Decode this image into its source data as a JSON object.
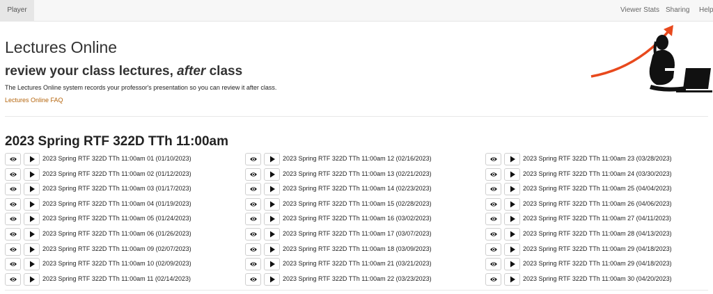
{
  "nav": {
    "player": "Player",
    "viewer_stats": "Viewer Stats",
    "sharing": "Sharing",
    "help": "Help"
  },
  "header": {
    "title": "Lectures Online",
    "subtitle_pre": "review your class lectures, ",
    "subtitle_em": "after",
    "subtitle_post": " class",
    "description": "The Lectures Online system records your professor's presentation so you can review it after class.",
    "faq_link": "Lectures Online FAQ"
  },
  "course": {
    "title": "2023 Spring RTF 322D TTh 11:00am",
    "lectures": [
      "2023 Spring RTF 322D TTh 11:00am 01 (01/10/2023)",
      "2023 Spring RTF 322D TTh 11:00am 02 (01/12/2023)",
      "2023 Spring RTF 322D TTh 11:00am 03 (01/17/2023)",
      "2023 Spring RTF 322D TTh 11:00am 04 (01/19/2023)",
      "2023 Spring RTF 322D TTh 11:00am 05 (01/24/2023)",
      "2023 Spring RTF 322D TTh 11:00am 06 (01/26/2023)",
      "2023 Spring RTF 322D TTh 11:00am 09 (02/07/2023)",
      "2023 Spring RTF 322D TTh 11:00am 10 (02/09/2023)",
      "2023 Spring RTF 322D TTh 11:00am 11 (02/14/2023)",
      "2023 Spring RTF 322D TTh 11:00am 12 (02/16/2023)",
      "2023 Spring RTF 322D TTh 11:00am 13 (02/21/2023)",
      "2023 Spring RTF 322D TTh 11:00am 14 (02/23/2023)",
      "2023 Spring RTF 322D TTh 11:00am 15 (02/28/2023)",
      "2023 Spring RTF 322D TTh 11:00am 16 (03/02/2023)",
      "2023 Spring RTF 322D TTh 11:00am 17 (03/07/2023)",
      "2023 Spring RTF 322D TTh 11:00am 18 (03/09/2023)",
      "2023 Spring RTF 322D TTh 11:00am 21 (03/21/2023)",
      "2023 Spring RTF 322D TTh 11:00am 22 (03/23/2023)",
      "2023 Spring RTF 322D TTh 11:00am 23 (03/28/2023)",
      "2023 Spring RTF 322D TTh 11:00am 24 (03/30/2023)",
      "2023 Spring RTF 322D TTh 11:00am 25 (04/04/2023)",
      "2023 Spring RTF 322D TTh 11:00am 26 (04/06/2023)",
      "2023 Spring RTF 322D TTh 11:00am 27 (04/11/2023)",
      "2023 Spring RTF 322D TTh 11:00am 28 (04/13/2023)",
      "2023 Spring RTF 322D TTh 11:00am 29 (04/18/2023)",
      "2023 Spring RTF 322D TTh 11:00am 29 (04/18/2023)",
      "2023 Spring RTF 322D TTh 11:00am 30 (04/20/2023)"
    ]
  },
  "icons": {
    "watch": "eye-icon",
    "play": "play-icon"
  },
  "colors": {
    "faq_link": "#b5650d",
    "arrow": "#e8491d",
    "navbar": "#f7f7f7"
  }
}
